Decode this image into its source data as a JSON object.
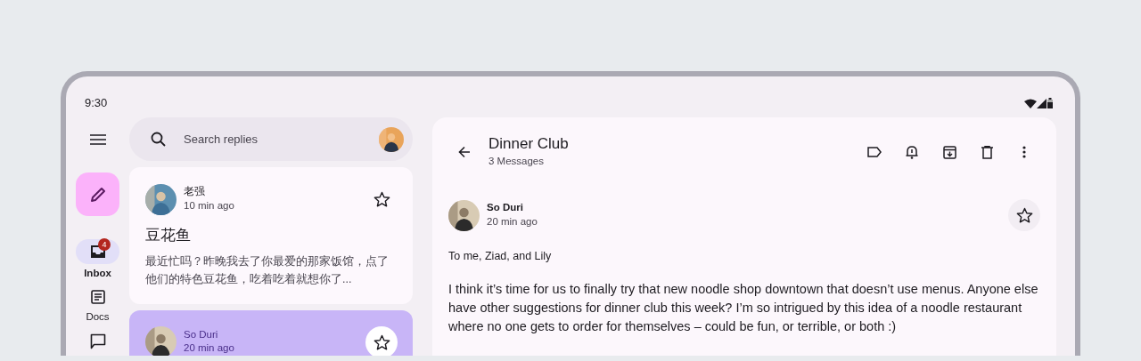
{
  "status_bar": {
    "time": "9:30"
  },
  "nav_rail": {
    "items": [
      {
        "label": "Inbox",
        "badge": "4",
        "selected": true
      },
      {
        "label": "Docs",
        "selected": false
      },
      {
        "selected": false
      }
    ]
  },
  "search": {
    "placeholder": "Search replies"
  },
  "emails": [
    {
      "sender": "老强",
      "time": "10 min ago",
      "subject": "豆花鱼",
      "preview": "最近忙吗？昨晚我去了你最爱的那家饭馆，点了他们的特色豆花鱼，吃着吃着就想你了...",
      "selected": false,
      "starred": false
    },
    {
      "sender": "So Duri",
      "time": "20 min ago",
      "selected": true,
      "starred": false
    }
  ],
  "detail": {
    "title": "Dinner Club",
    "subtitle": "3 Messages",
    "message": {
      "sender": "So Duri",
      "time": "20 min ago",
      "starred": false,
      "recipients": "To me, Ziad, and Lily",
      "body": "I think it’s time for us to finally try that new noodle shop downtown that doesn’t use menus. Anyone else have other suggestions for dinner club this week? I’m so intrigued by this idea of a noodle restaurant where no one gets to order for themselves – could be fun, or terrible, or both :)"
    }
  }
}
